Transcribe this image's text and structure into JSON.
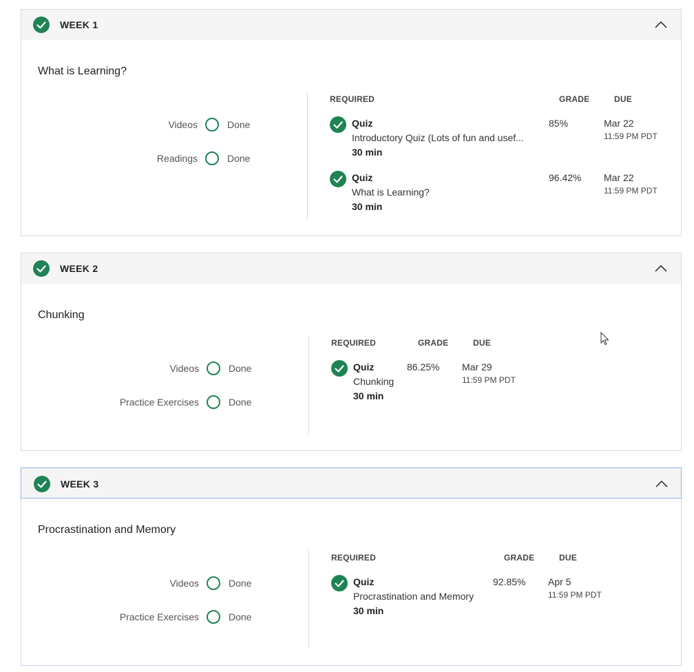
{
  "colors": {
    "accent": "#1f8354",
    "header_bg": "#f5f5f5",
    "border": "#dadada"
  },
  "weeks": [
    {
      "title": "WEEK 1",
      "module_title": "What is Learning?",
      "activities": [
        {
          "label": "Videos",
          "status": "Done"
        },
        {
          "label": "Readings",
          "status": "Done"
        }
      ],
      "columns": {
        "required": "REQUIRED",
        "grade": "GRADE",
        "due": "DUE"
      },
      "items": [
        {
          "type": "Quiz",
          "name": "Introductory Quiz (Lots of fun and usef...",
          "duration": "30 min",
          "grade": "85%",
          "due_date": "Mar 22",
          "due_time": "11:59 PM PDT"
        },
        {
          "type": "Quiz",
          "name": "What is Learning?",
          "duration": "30 min",
          "grade": "96.42%",
          "due_date": "Mar 22",
          "due_time": "11:59 PM PDT"
        }
      ]
    },
    {
      "title": "WEEK 2",
      "module_title": "Chunking",
      "activities": [
        {
          "label": "Videos",
          "status": "Done"
        },
        {
          "label": "Practice Exercises",
          "status": "Done"
        }
      ],
      "columns": {
        "required": "REQUIRED",
        "grade": "GRADE",
        "due": "DUE"
      },
      "items": [
        {
          "type": "Quiz",
          "name": "Chunking",
          "duration": "30 min",
          "grade": "86.25%",
          "due_date": "Mar 29",
          "due_time": "11:59 PM PDT"
        }
      ]
    },
    {
      "title": "WEEK 3",
      "module_title": "Procrastination and Memory",
      "activities": [
        {
          "label": "Videos",
          "status": "Done"
        },
        {
          "label": "Practice Exercises",
          "status": "Done"
        }
      ],
      "columns": {
        "required": "REQUIRED",
        "grade": "GRADE",
        "due": "DUE"
      },
      "items": [
        {
          "type": "Quiz",
          "name": "Procrastination and Memory",
          "duration": "30 min",
          "grade": "92.85%",
          "due_date": "Apr 5",
          "due_time": "11:59 PM PDT"
        }
      ]
    }
  ]
}
